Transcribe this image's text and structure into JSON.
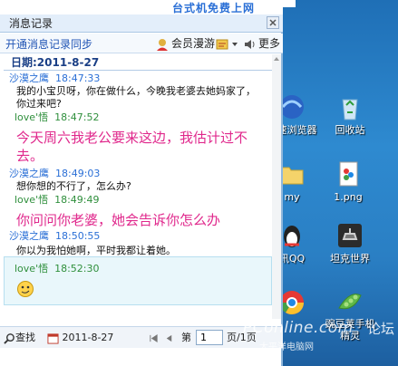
{
  "window": {
    "title": "消息记录",
    "banner_text": "台式机免费上网"
  },
  "toolbar": {
    "sync_link": "开通消息记录同步",
    "member_roam": "会员漫游",
    "more": "更多"
  },
  "date_header": "日期:2011-8-27",
  "messages": [
    {
      "sender": "沙漠之鹰",
      "time": "18:47:33",
      "text": "我的小宝贝呀，你在做什么，今晚我老婆去她妈家了，你过来吧?"
    },
    {
      "sender": "love'悟",
      "time": "18:47:52",
      "text": "今天周六我老公要来这边，我估计过不去。"
    },
    {
      "sender": "沙漠之鹰",
      "time": "18:49:03",
      "text": "想你想的不行了，怎么办?"
    },
    {
      "sender": "love'悟",
      "time": "18:49:49",
      "text": "你问问你老婆，她会告诉你怎么办"
    },
    {
      "sender": "沙漠之鹰",
      "time": "18:50:55",
      "text": "你以为我怕她啊，平时我都让着她。"
    },
    {
      "sender": "love'悟",
      "time": "18:52:30",
      "text": ""
    }
  ],
  "footer": {
    "search": "查找",
    "date": "2011-8-27",
    "page_prefix": "第",
    "page_value": "1",
    "page_suffix": "页/1页"
  },
  "desktop": {
    "icons": [
      {
        "label": "高速浏览器"
      },
      {
        "label": "回收站"
      },
      {
        "label": "my"
      },
      {
        "label": "1.png"
      },
      {
        "label": "讯QQ"
      },
      {
        "label": "坦克世界"
      },
      {
        "label": "豌豆荚手机精灵"
      }
    ],
    "watermark": "PConline.com",
    "watermark_forum": "论坛",
    "watermark_sub": "太平洋电脑网"
  }
}
